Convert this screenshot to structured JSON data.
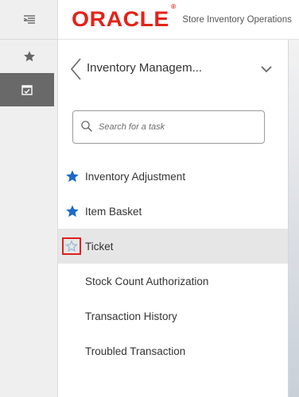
{
  "header": {
    "brand": "ORACLE",
    "brand_mark": "®",
    "app_title": "Store Inventory Operations"
  },
  "rail": {
    "menu_icon": "menu-collapse-icon",
    "favorites_icon": "star-icon",
    "tasks_icon": "tasks-icon"
  },
  "panel": {
    "title": "Inventory Managem...",
    "back_icon": "chevron-left-icon",
    "dropdown_icon": "chevron-down-icon",
    "search": {
      "placeholder": "Search for a task",
      "value": ""
    },
    "tasks": [
      {
        "label": "Inventory Adjustment",
        "favorite": "filled"
      },
      {
        "label": "Item Basket",
        "favorite": "filled"
      },
      {
        "label": "Ticket",
        "favorite": "outline"
      },
      {
        "label": "Stock Count Authorization",
        "favorite": "none"
      },
      {
        "label": "Transaction History",
        "favorite": "none"
      },
      {
        "label": "Troubled Transaction",
        "favorite": "none"
      }
    ]
  },
  "colors": {
    "brand_red": "#e2231a",
    "star_blue": "#1b6ac9",
    "star_outline": "#8fb0d8",
    "selected_row": "#e6e6e6",
    "highlight_box": "#e02020",
    "rail_active": "#696969"
  }
}
